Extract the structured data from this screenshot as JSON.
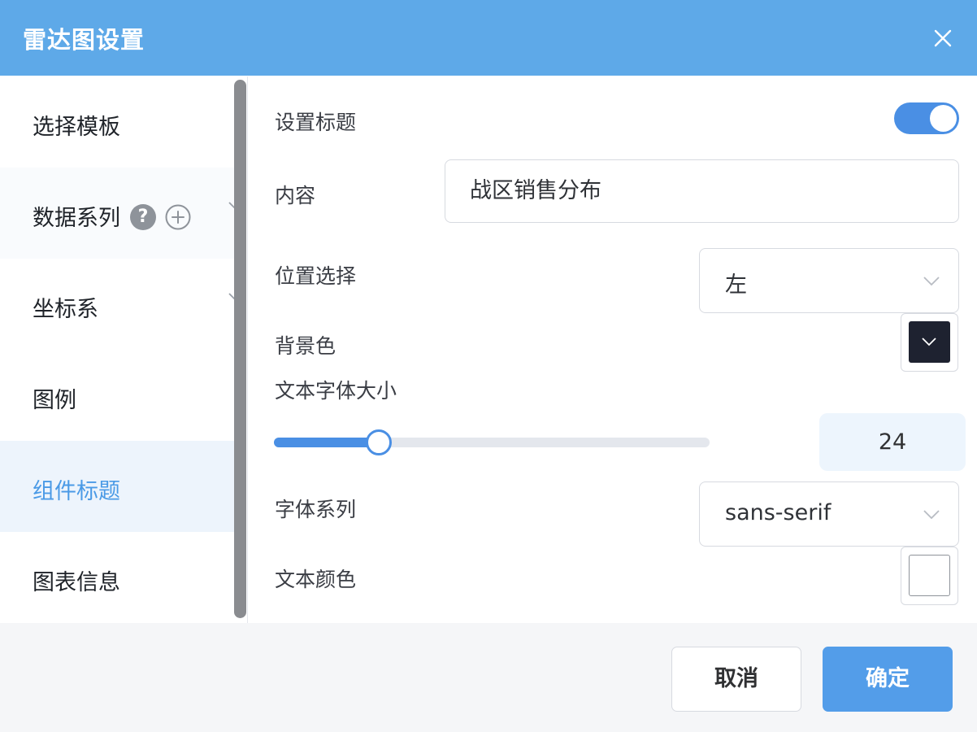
{
  "dialog": {
    "title": "雷达图设置",
    "close_icon": "close-icon"
  },
  "sidebar": {
    "items": [
      {
        "label": "选择模板"
      },
      {
        "label": "数据系列",
        "icons": [
          "help-icon",
          "add-circle-icon"
        ],
        "help_glyph": "?",
        "expandable": true
      },
      {
        "label": "坐标系",
        "expandable": true
      },
      {
        "label": "图例"
      },
      {
        "label": "组件标题",
        "active": true
      },
      {
        "label": "图表信息"
      }
    ]
  },
  "form": {
    "show_title": {
      "label": "设置标题",
      "value": true
    },
    "content": {
      "label": "内容",
      "value": "战区销售分布"
    },
    "position": {
      "label": "位置选择",
      "value": "左"
    },
    "background_color": {
      "label": "背景色",
      "value": "#1e2230"
    },
    "font_size": {
      "label": "文本字体大小",
      "value": "24",
      "slider_fraction": 0.24
    },
    "font_family": {
      "label": "字体系列",
      "value": "sans-serif"
    },
    "text_color": {
      "label": "文本颜色",
      "value": "#ffffff"
    }
  },
  "footer": {
    "cancel_label": "取消",
    "confirm_label": "确定"
  },
  "colors": {
    "header": "#5ea9e8",
    "accent": "#4a8fe4",
    "active_nav_text": "#4a9ae6",
    "active_nav_bg": "#edf4fc"
  }
}
